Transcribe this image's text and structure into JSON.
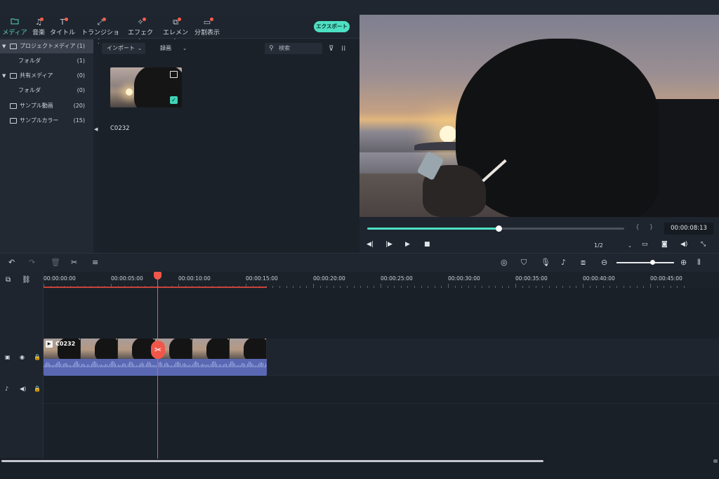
{
  "tabs": [
    {
      "label": "メディア",
      "icon": "folder-icon",
      "dot": false
    },
    {
      "label": "音楽",
      "icon": "music-note-icon",
      "dot": true
    },
    {
      "label": "タイトル",
      "icon": "title-t-icon",
      "dot": true
    },
    {
      "label": "トランジション",
      "icon": "transition-icon",
      "dot": true
    },
    {
      "label": "エフェクト",
      "icon": "effect-sparkle-icon",
      "dot": true
    },
    {
      "label": "エレメント",
      "icon": "element-icon",
      "dot": true
    },
    {
      "label": "分割表示",
      "icon": "split-screen-icon",
      "dot": true
    }
  ],
  "export_label": "エクスポート",
  "sidebar": {
    "items": [
      {
        "label": "プロジェクトメディア",
        "count": "(1)"
      },
      {
        "label": "フォルダ",
        "count": "(1)"
      },
      {
        "label": "共有メディア",
        "count": "(0)"
      },
      {
        "label": "フォルダ",
        "count": "(0)"
      },
      {
        "label": "サンプル動画",
        "count": "(20)"
      },
      {
        "label": "サンプルカラー",
        "count": "(15)"
      }
    ]
  },
  "media": {
    "import_label": "インポート",
    "record_label": "録画",
    "search_placeholder": "検索",
    "thumb_name": "C0232"
  },
  "preview": {
    "progress": 0.51,
    "timecode": "00:00:08:13",
    "ratio": "1/2"
  },
  "timeline": {
    "ticks": [
      "00:00:00:00",
      "00:00:05:00",
      "00:00:10:00",
      "00:00:15:00",
      "00:00:20:00",
      "00:00:25:00",
      "00:00:30:00",
      "00:00:35:00",
      "00:00:40:00",
      "00:00:45:00"
    ],
    "clip_name": "C0232",
    "zoom": 0.62
  },
  "colors": {
    "accent": "#4ee0c3",
    "playhead": "#f0574a",
    "waveform": "#5a68b3"
  }
}
